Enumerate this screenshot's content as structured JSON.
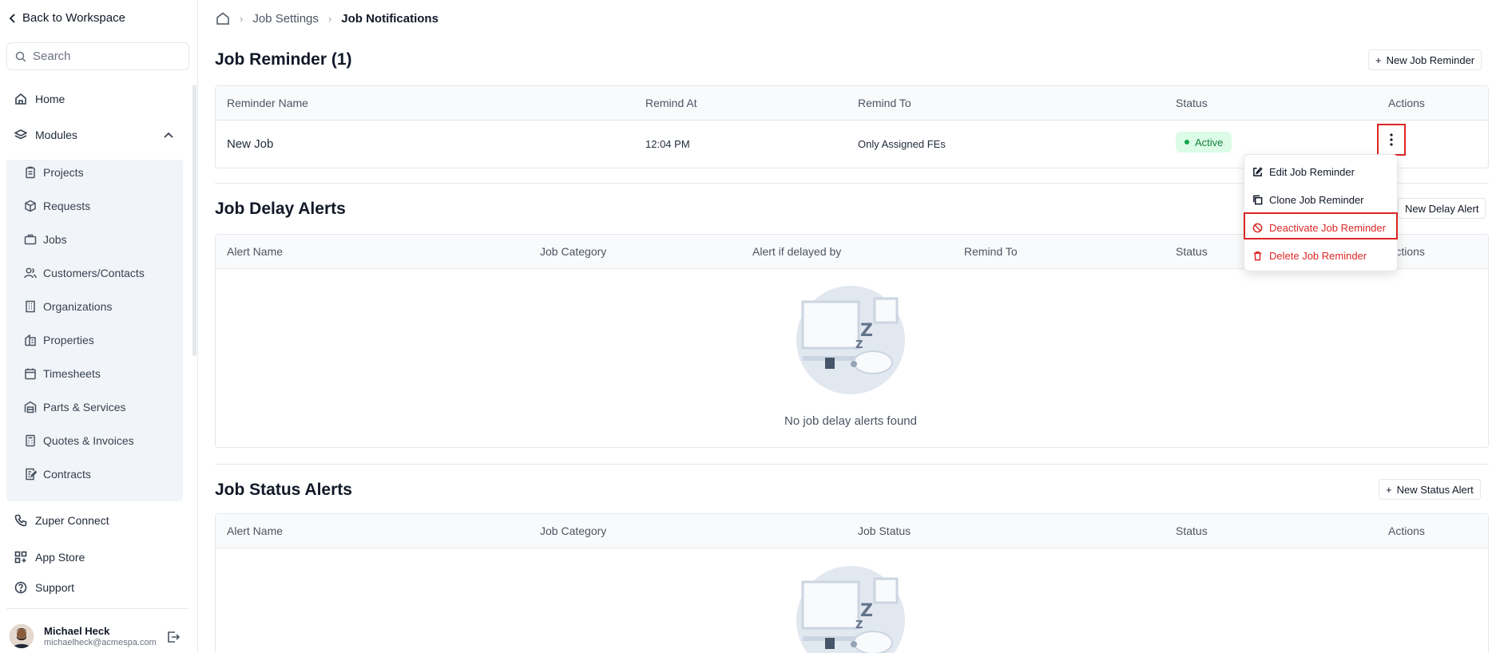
{
  "sidebar": {
    "back_label": "Back to Workspace",
    "search_placeholder": "Search",
    "nav": {
      "home": "Home",
      "modules": "Modules",
      "zuper_connect": "Zuper Connect",
      "app_store": "App Store",
      "support": "Support"
    },
    "modules": [
      "Projects",
      "Requests",
      "Jobs",
      "Customers/Contacts",
      "Organizations",
      "Properties",
      "Timesheets",
      "Parts & Services",
      "Quotes & Invoices",
      "Contracts"
    ],
    "user": {
      "name": "Michael Heck",
      "email": "michaelheck@acmespa.com"
    }
  },
  "breadcrumb": {
    "parent": "Job Settings",
    "current": "Job Notifications"
  },
  "job_reminder": {
    "title": "Job Reminder (1)",
    "new_button": "New Job Reminder",
    "columns": [
      "Reminder Name",
      "Remind At",
      "Remind To",
      "Status",
      "Actions"
    ],
    "rows": [
      {
        "name": "New Job",
        "remind_at": "12:04 PM",
        "remind_to": "Only Assigned FEs",
        "status": "Active"
      }
    ]
  },
  "job_delay_alerts": {
    "title": "Job Delay Alerts",
    "new_button": "New Delay Alert",
    "columns": [
      "Alert Name",
      "Job Category",
      "Alert if delayed by",
      "Remind To",
      "Status",
      "Actions"
    ],
    "empty_text": "No job delay alerts found"
  },
  "job_status_alerts": {
    "title": "Job Status Alerts",
    "new_button": "New Status Alert",
    "columns": [
      "Alert Name",
      "Job Category",
      "Job Status",
      "Status",
      "Actions"
    ]
  },
  "action_menu": {
    "items": [
      "Edit Job Reminder",
      "Clone Job Reminder",
      "Deactivate Job Reminder",
      "Delete Job Reminder"
    ]
  },
  "colors": {
    "accent_red": "#dc2626",
    "active_green": "#15803d",
    "subnav_bg": "#f1f5f9"
  }
}
